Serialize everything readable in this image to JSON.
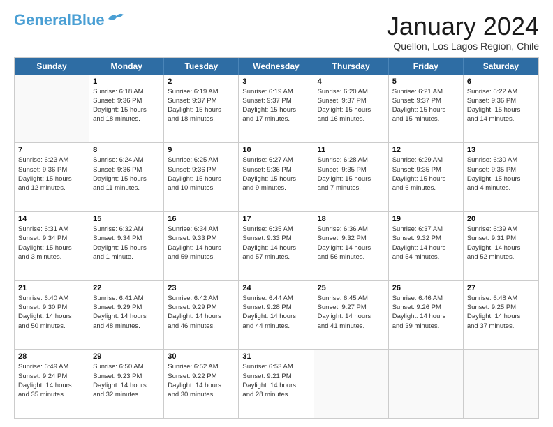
{
  "header": {
    "logo_line1": "General",
    "logo_line2": "Blue",
    "month_title": "January 2024",
    "subtitle": "Quellon, Los Lagos Region, Chile"
  },
  "weekdays": [
    "Sunday",
    "Monday",
    "Tuesday",
    "Wednesday",
    "Thursday",
    "Friday",
    "Saturday"
  ],
  "rows": [
    [
      {
        "day": "",
        "text": ""
      },
      {
        "day": "1",
        "text": "Sunrise: 6:18 AM\nSunset: 9:36 PM\nDaylight: 15 hours\nand 18 minutes."
      },
      {
        "day": "2",
        "text": "Sunrise: 6:19 AM\nSunset: 9:37 PM\nDaylight: 15 hours\nand 18 minutes."
      },
      {
        "day": "3",
        "text": "Sunrise: 6:19 AM\nSunset: 9:37 PM\nDaylight: 15 hours\nand 17 minutes."
      },
      {
        "day": "4",
        "text": "Sunrise: 6:20 AM\nSunset: 9:37 PM\nDaylight: 15 hours\nand 16 minutes."
      },
      {
        "day": "5",
        "text": "Sunrise: 6:21 AM\nSunset: 9:37 PM\nDaylight: 15 hours\nand 15 minutes."
      },
      {
        "day": "6",
        "text": "Sunrise: 6:22 AM\nSunset: 9:36 PM\nDaylight: 15 hours\nand 14 minutes."
      }
    ],
    [
      {
        "day": "7",
        "text": "Sunrise: 6:23 AM\nSunset: 9:36 PM\nDaylight: 15 hours\nand 12 minutes."
      },
      {
        "day": "8",
        "text": "Sunrise: 6:24 AM\nSunset: 9:36 PM\nDaylight: 15 hours\nand 11 minutes."
      },
      {
        "day": "9",
        "text": "Sunrise: 6:25 AM\nSunset: 9:36 PM\nDaylight: 15 hours\nand 10 minutes."
      },
      {
        "day": "10",
        "text": "Sunrise: 6:27 AM\nSunset: 9:36 PM\nDaylight: 15 hours\nand 9 minutes."
      },
      {
        "day": "11",
        "text": "Sunrise: 6:28 AM\nSunset: 9:35 PM\nDaylight: 15 hours\nand 7 minutes."
      },
      {
        "day": "12",
        "text": "Sunrise: 6:29 AM\nSunset: 9:35 PM\nDaylight: 15 hours\nand 6 minutes."
      },
      {
        "day": "13",
        "text": "Sunrise: 6:30 AM\nSunset: 9:35 PM\nDaylight: 15 hours\nand 4 minutes."
      }
    ],
    [
      {
        "day": "14",
        "text": "Sunrise: 6:31 AM\nSunset: 9:34 PM\nDaylight: 15 hours\nand 3 minutes."
      },
      {
        "day": "15",
        "text": "Sunrise: 6:32 AM\nSunset: 9:34 PM\nDaylight: 15 hours\nand 1 minute."
      },
      {
        "day": "16",
        "text": "Sunrise: 6:34 AM\nSunset: 9:33 PM\nDaylight: 14 hours\nand 59 minutes."
      },
      {
        "day": "17",
        "text": "Sunrise: 6:35 AM\nSunset: 9:33 PM\nDaylight: 14 hours\nand 57 minutes."
      },
      {
        "day": "18",
        "text": "Sunrise: 6:36 AM\nSunset: 9:32 PM\nDaylight: 14 hours\nand 56 minutes."
      },
      {
        "day": "19",
        "text": "Sunrise: 6:37 AM\nSunset: 9:32 PM\nDaylight: 14 hours\nand 54 minutes."
      },
      {
        "day": "20",
        "text": "Sunrise: 6:39 AM\nSunset: 9:31 PM\nDaylight: 14 hours\nand 52 minutes."
      }
    ],
    [
      {
        "day": "21",
        "text": "Sunrise: 6:40 AM\nSunset: 9:30 PM\nDaylight: 14 hours\nand 50 minutes."
      },
      {
        "day": "22",
        "text": "Sunrise: 6:41 AM\nSunset: 9:29 PM\nDaylight: 14 hours\nand 48 minutes."
      },
      {
        "day": "23",
        "text": "Sunrise: 6:42 AM\nSunset: 9:29 PM\nDaylight: 14 hours\nand 46 minutes."
      },
      {
        "day": "24",
        "text": "Sunrise: 6:44 AM\nSunset: 9:28 PM\nDaylight: 14 hours\nand 44 minutes."
      },
      {
        "day": "25",
        "text": "Sunrise: 6:45 AM\nSunset: 9:27 PM\nDaylight: 14 hours\nand 41 minutes."
      },
      {
        "day": "26",
        "text": "Sunrise: 6:46 AM\nSunset: 9:26 PM\nDaylight: 14 hours\nand 39 minutes."
      },
      {
        "day": "27",
        "text": "Sunrise: 6:48 AM\nSunset: 9:25 PM\nDaylight: 14 hours\nand 37 minutes."
      }
    ],
    [
      {
        "day": "28",
        "text": "Sunrise: 6:49 AM\nSunset: 9:24 PM\nDaylight: 14 hours\nand 35 minutes."
      },
      {
        "day": "29",
        "text": "Sunrise: 6:50 AM\nSunset: 9:23 PM\nDaylight: 14 hours\nand 32 minutes."
      },
      {
        "day": "30",
        "text": "Sunrise: 6:52 AM\nSunset: 9:22 PM\nDaylight: 14 hours\nand 30 minutes."
      },
      {
        "day": "31",
        "text": "Sunrise: 6:53 AM\nSunset: 9:21 PM\nDaylight: 14 hours\nand 28 minutes."
      },
      {
        "day": "",
        "text": ""
      },
      {
        "day": "",
        "text": ""
      },
      {
        "day": "",
        "text": ""
      }
    ]
  ]
}
